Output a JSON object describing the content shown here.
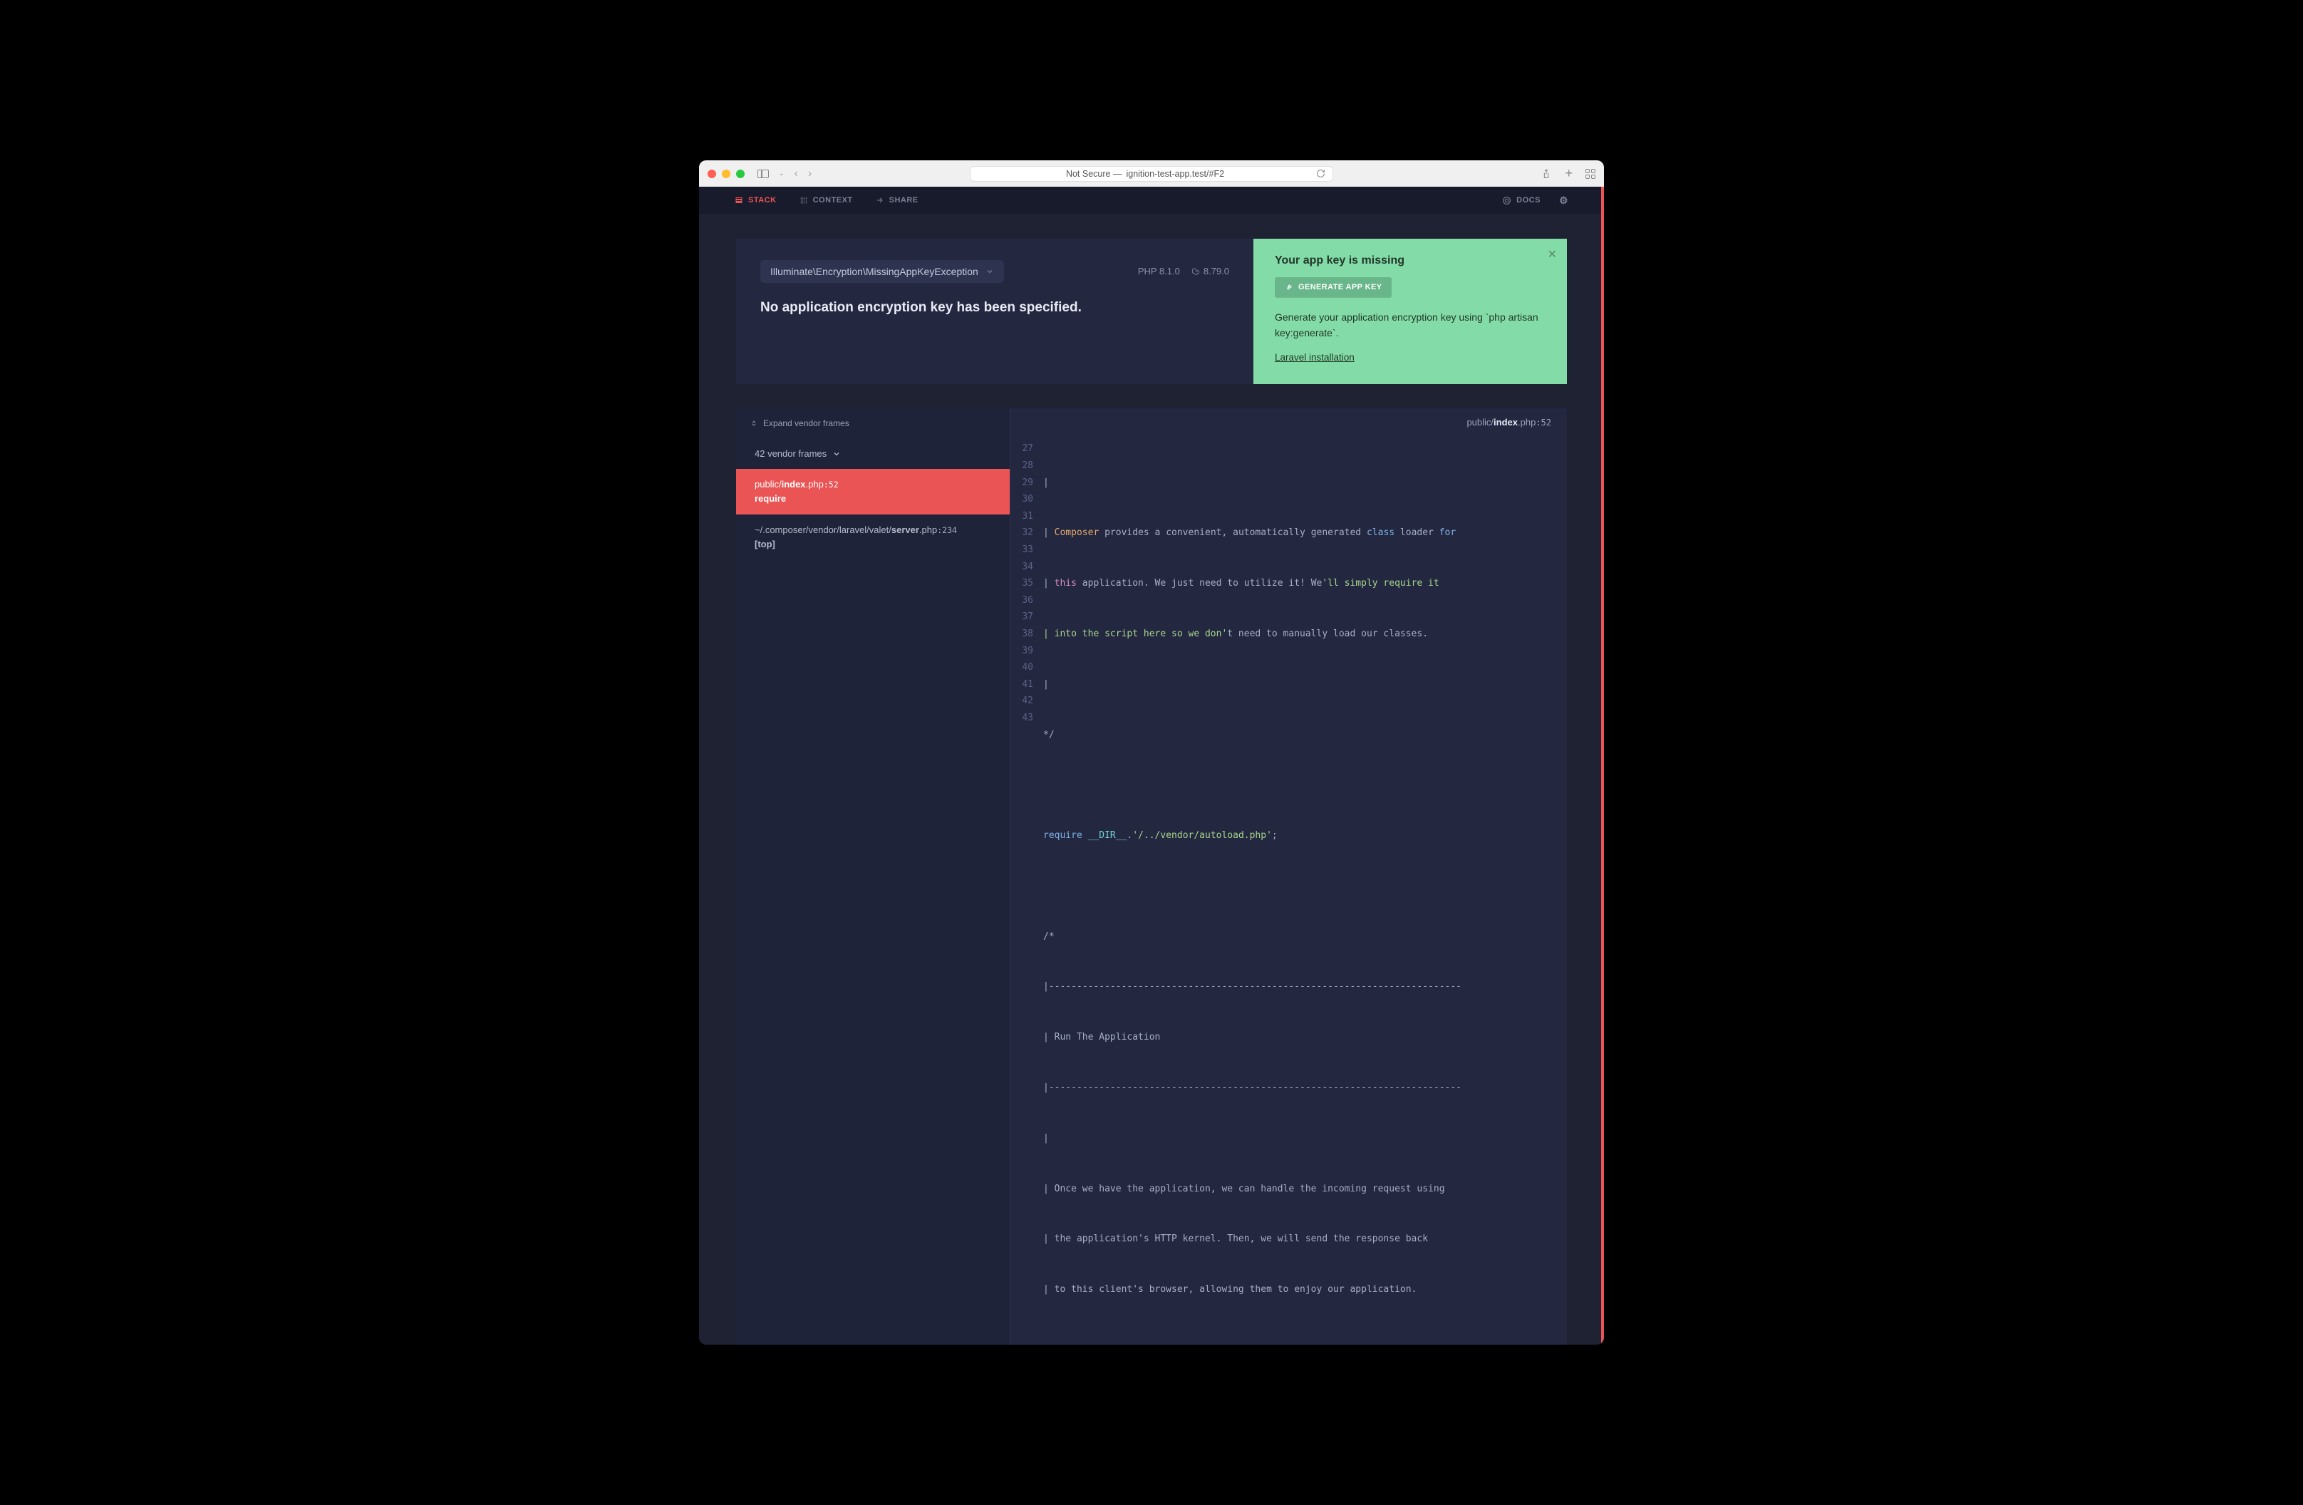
{
  "browser": {
    "address_prefix": "Not Secure — ",
    "address": "ignition-test-app.test/#F2"
  },
  "nav": {
    "stack": "STACK",
    "context": "CONTEXT",
    "share": "SHARE",
    "docs": "DOCS"
  },
  "header": {
    "exception_class": "Illuminate\\Encryption\\MissingAppKeyException",
    "php_version": "PHP 8.1.0",
    "laravel_version": "8.79.0",
    "message": "No application encryption key has been specified."
  },
  "solution": {
    "title": "Your app key is missing",
    "button": "GENERATE APP KEY",
    "description": "Generate your application encryption key using `php artisan key:generate`.",
    "link_text": "Laravel installation"
  },
  "frames": {
    "expand_label": "Expand vendor frames",
    "vendor_group": "42 vendor frames",
    "f1_path_a": "public/",
    "f1_path_b": "index",
    "f1_path_c": ".php",
    "f1_line": ":52",
    "f1_func": "require",
    "f2_path_a": "~/.composer/vendor/laravel/valet/",
    "f2_path_b": "server",
    "f2_path_c": ".php",
    "f2_line": ":234",
    "f2_func": "[top]"
  },
  "code_header": {
    "a": "public/",
    "b": "index",
    "c": ".php",
    "line": ":52"
  },
  "code": {
    "l27": "|",
    "l28a": "| ",
    "l28b": "Composer",
    "l28c": " provides a convenient, automatically generated ",
    "l28d": "class",
    "l28e": " loader ",
    "l28f": "for",
    "l29a": "| ",
    "l29b": "this",
    "l29c": " application. We just need to utilize it! We",
    "l29d": "'ll simply require it",
    "l30a": "| into the script here so we don'",
    "l30b": "t need to manually load our classes.",
    "l31": "|",
    "l32": "*/",
    "l33": "",
    "l34a": "require",
    "l34b": " ",
    "l34c": "__DIR__",
    "l34d": ".",
    "l34e": "'/../vendor/autoload.php'",
    "l34f": ";",
    "l35": "",
    "l36": "/*",
    "l37": "|--------------------------------------------------------------------------",
    "l38": "| Run The Application",
    "l39": "|--------------------------------------------------------------------------",
    "l40": "|",
    "l41": "| Once we have the application, we can handle the incoming request using",
    "l42": "| the application's HTTP kernel. Then, we will send the response back",
    "l43": "| to this client's browser, allowing them to enjoy our application."
  },
  "gutter": [
    "27",
    "28",
    "29",
    "30",
    "31",
    "32",
    "33",
    "34",
    "35",
    "36",
    "37",
    "38",
    "39",
    "40",
    "41",
    "42",
    "43"
  ]
}
